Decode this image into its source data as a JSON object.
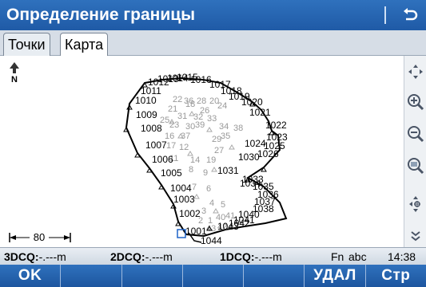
{
  "title": "Определение границы",
  "tabs": [
    "Точки",
    "Карта"
  ],
  "map": {
    "north_label": "N",
    "scale_label": "80",
    "point_labels": {
      "p1": "1011",
      "p2": "1010",
      "p3": "1009",
      "p4": "1008",
      "p5": "1007",
      "p6": "1006",
      "p7": "1005",
      "p8": "1004",
      "p9": "1003",
      "p10": "1002",
      "p11": "1001",
      "p12": "1044",
      "p13": "1043",
      "p14": "1042",
      "p15": "1041",
      "p16": "1040",
      "p17": "1038",
      "p18": "1037",
      "p19": "1036",
      "p20": "1035",
      "p21": "1034",
      "p22": "1033",
      "p23": "1031",
      "p24": "1030",
      "p25": "1026",
      "p26": "1025",
      "p27": "1024",
      "p28": "1023",
      "p29": "1022",
      "p30": "1021",
      "p31": "1020",
      "p32": "1019",
      "p33": "1018",
      "p34": "1017",
      "p35": "1016",
      "p36": "1015",
      "p37": "1014",
      "p38": "1013",
      "p39": "1012",
      "g1": "30",
      "g2": "31",
      "g3": "32",
      "g4": "33",
      "g5": "34",
      "g6": "35",
      "g7": "36",
      "g8": "37",
      "g9": "38",
      "g10": "39",
      "g11": "29",
      "g12": "28",
      "g13": "27",
      "g14": "26",
      "g15": "25",
      "g16": "24",
      "g17": "23",
      "g18": "22",
      "g19": "21",
      "g20": "20",
      "g21": "19",
      "g22": "18",
      "g23": "17",
      "g24": "16",
      "g25": "14",
      "g26": "12",
      "g27": "11",
      "g28": "9",
      "g29": "8",
      "g30": "7",
      "g31": "6",
      "g32": "5",
      "g33": "4",
      "g34": "3",
      "g35": "2",
      "g36": "1",
      "g37": "40",
      "g38": "41",
      "g39": "42",
      "g40": "43"
    }
  },
  "status": {
    "q3_label": "3DCQ:",
    "q3_value": "-.---m",
    "q2_label": "2DCQ:",
    "q2_value": "-.---m",
    "q1_label": "1DCQ:",
    "q1_value": "-.---m",
    "fn": "Fn",
    "mode": "abc",
    "time": "14:38"
  },
  "softkeys": [
    "OK",
    "",
    "",
    "",
    "",
    "УДАЛ",
    "Стр"
  ]
}
